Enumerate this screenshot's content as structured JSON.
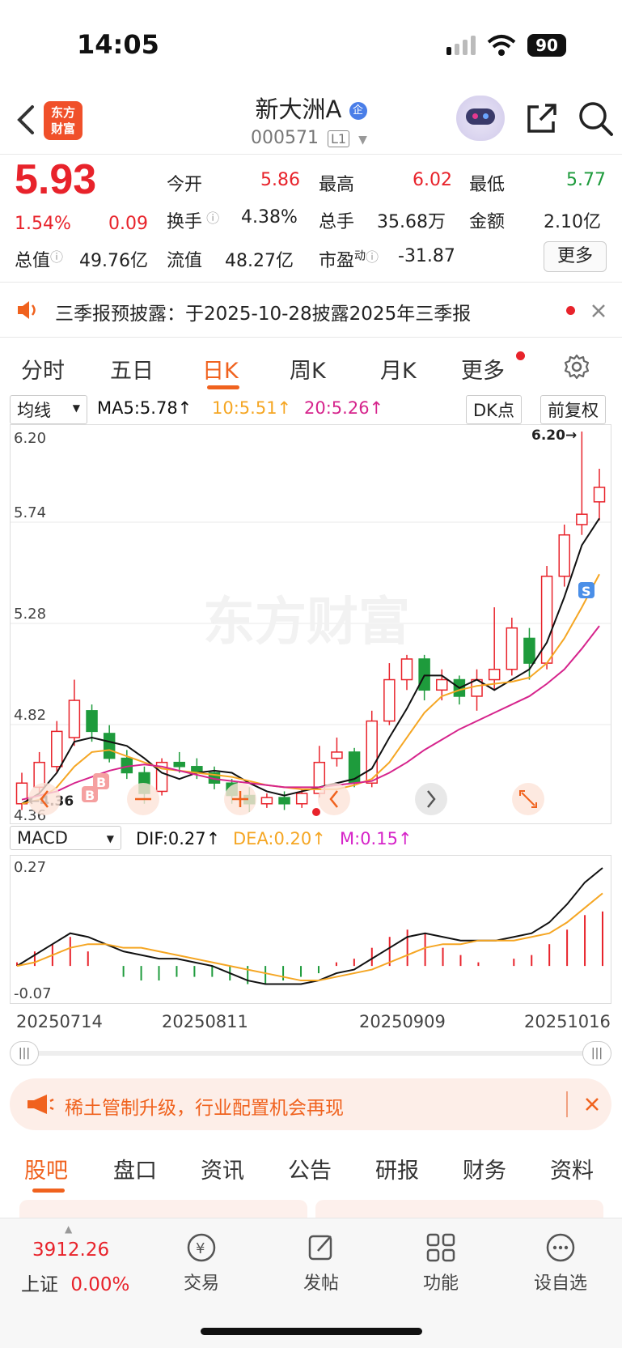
{
  "status": {
    "time": "14:05",
    "battery": "90"
  },
  "header": {
    "logo_text": "东方财富",
    "title": "新大洲A",
    "code": "000571",
    "level_badge": "L1"
  },
  "quote": {
    "price": "5.93",
    "change_pct": "1.54%",
    "change": "0.09",
    "open_label": "今开",
    "open_value": "5.86",
    "high_label": "最高",
    "high_value": "6.02",
    "low_label": "最低",
    "low_value": "5.77",
    "turnover_label": "换手",
    "turnover_value": "4.38%",
    "volume_label": "总手",
    "volume_value": "35.68万",
    "amount_label": "金额",
    "amount_value": "2.10亿",
    "total_mv_label": "总值",
    "total_mv_value": "49.76亿",
    "float_mv_label": "流值",
    "float_mv_value": "48.27亿",
    "pe_label": "市盈",
    "pe_superscript": "动",
    "pe_value": "-31.87",
    "more_button": "更多"
  },
  "notice": {
    "text": "三季报预披露：于2025-10-28披露2025年三季报"
  },
  "period_tabs": {
    "items": [
      "分时",
      "五日",
      "日K",
      "周K",
      "月K",
      "更多"
    ],
    "active": "日K"
  },
  "indicator_bar": {
    "ma_select": "均线",
    "ma5": "MA5:5.78↑",
    "ma10": "10:5.51↑",
    "ma20": "20:5.26↑",
    "dk_button": "DK点",
    "adjust_button": "前复权"
  },
  "colors": {
    "up": "#e8232b",
    "down": "#1e9b3c",
    "ma5": "#111111",
    "ma10": "#f5a623",
    "ma20": "#d6248c",
    "accent": "#f0621e"
  },
  "chart_data": [
    {
      "type": "candlestick",
      "y_ticks": [
        "6.20",
        "5.74",
        "5.28",
        "4.82",
        "4.36"
      ],
      "ylim": [
        4.36,
        6.2
      ],
      "max_label": "6.20→",
      "min_label": "←4.36",
      "watermark": "东方财富",
      "markers": [
        "B",
        "B",
        "S"
      ],
      "series": [
        {
          "name": "MA5",
          "values": [
            4.4,
            4.45,
            4.55,
            4.7,
            4.72,
            4.7,
            4.68,
            4.62,
            4.55,
            4.52,
            4.55,
            4.56,
            4.55,
            4.5,
            4.46,
            4.44,
            4.46,
            4.48,
            4.5,
            4.52,
            4.57,
            4.72,
            4.86,
            5.02,
            5.02,
            4.96,
            5.0,
            4.95,
            5.0,
            5.05,
            5.18,
            5.4,
            5.65,
            5.78
          ]
        },
        {
          "name": "10",
          "values": [
            4.4,
            4.42,
            4.48,
            4.58,
            4.65,
            4.66,
            4.63,
            4.6,
            4.57,
            4.56,
            4.55,
            4.54,
            4.53,
            4.51,
            4.49,
            4.48,
            4.47,
            4.47,
            4.47,
            4.49,
            4.52,
            4.6,
            4.72,
            4.84,
            4.92,
            4.95,
            4.97,
            4.98,
            4.99,
            5.01,
            5.08,
            5.2,
            5.35,
            5.51
          ]
        },
        {
          "name": "20",
          "values": [
            4.42,
            4.44,
            4.46,
            4.5,
            4.53,
            4.56,
            4.58,
            4.59,
            4.58,
            4.56,
            4.54,
            4.52,
            4.51,
            4.5,
            4.49,
            4.48,
            4.48,
            4.48,
            4.49,
            4.5,
            4.51,
            4.55,
            4.6,
            4.66,
            4.71,
            4.76,
            4.8,
            4.84,
            4.88,
            4.92,
            4.98,
            5.05,
            5.15,
            5.26
          ]
        }
      ],
      "candles": [
        [
          4.4,
          4.5,
          4.55,
          4.37
        ],
        [
          4.48,
          4.6,
          4.65,
          4.45
        ],
        [
          4.58,
          4.75,
          4.8,
          4.55
        ],
        [
          4.72,
          4.9,
          5.0,
          4.68
        ],
        [
          4.85,
          4.75,
          4.88,
          4.7
        ],
        [
          4.74,
          4.62,
          4.78,
          4.6
        ],
        [
          4.62,
          4.55,
          4.66,
          4.52
        ],
        [
          4.55,
          4.45,
          4.58,
          4.4
        ],
        [
          4.46,
          4.6,
          4.62,
          4.44
        ],
        [
          4.6,
          4.58,
          4.65,
          4.55
        ],
        [
          4.58,
          4.55,
          4.62,
          4.52
        ],
        [
          4.55,
          4.5,
          4.58,
          4.47
        ],
        [
          4.5,
          4.44,
          4.52,
          4.4
        ],
        [
          4.44,
          4.4,
          4.48,
          4.36
        ],
        [
          4.4,
          4.43,
          4.45,
          4.38
        ],
        [
          4.43,
          4.4,
          4.46,
          4.37
        ],
        [
          4.4,
          4.45,
          4.47,
          4.38
        ],
        [
          4.45,
          4.6,
          4.68,
          4.43
        ],
        [
          4.62,
          4.65,
          4.72,
          4.58
        ],
        [
          4.65,
          4.5,
          4.67,
          4.48
        ],
        [
          4.5,
          4.8,
          4.85,
          4.48
        ],
        [
          4.8,
          5.0,
          5.08,
          4.78
        ],
        [
          5.0,
          5.1,
          5.12,
          4.95
        ],
        [
          5.1,
          4.95,
          5.12,
          4.9
        ],
        [
          4.95,
          5.0,
          5.05,
          4.9
        ],
        [
          5.0,
          4.92,
          5.02,
          4.88
        ],
        [
          4.92,
          5.0,
          5.05,
          4.85
        ],
        [
          5.0,
          5.05,
          5.35,
          4.95
        ],
        [
          5.05,
          5.25,
          5.3,
          5.02
        ],
        [
          5.2,
          5.08,
          5.25,
          5.0
        ],
        [
          5.08,
          5.5,
          5.55,
          5.05
        ],
        [
          5.5,
          5.7,
          5.75,
          5.45
        ],
        [
          5.75,
          5.8,
          6.2,
          5.7
        ],
        [
          5.86,
          5.93,
          6.02,
          5.77
        ]
      ]
    },
    {
      "type": "macd",
      "y_ticks": [
        "0.27",
        "-0.07"
      ],
      "series": [
        {
          "name": "DIF",
          "label": "DIF:0.27↑"
        },
        {
          "name": "DEA",
          "label": "DEA:0.20↑"
        },
        {
          "name": "M",
          "label": "M:0.15↑"
        }
      ],
      "dif": [
        0.0,
        0.03,
        0.06,
        0.09,
        0.08,
        0.06,
        0.04,
        0.03,
        0.02,
        0.02,
        0.01,
        0.0,
        -0.02,
        -0.04,
        -0.05,
        -0.05,
        -0.05,
        -0.04,
        -0.02,
        -0.01,
        0.02,
        0.05,
        0.08,
        0.09,
        0.08,
        0.07,
        0.07,
        0.07,
        0.08,
        0.09,
        0.12,
        0.17,
        0.23,
        0.27
      ],
      "dea": [
        0.0,
        0.01,
        0.03,
        0.05,
        0.06,
        0.06,
        0.05,
        0.05,
        0.04,
        0.03,
        0.02,
        0.01,
        0.0,
        -0.01,
        -0.02,
        -0.03,
        -0.04,
        -0.04,
        -0.03,
        -0.02,
        -0.01,
        0.01,
        0.03,
        0.05,
        0.06,
        0.06,
        0.07,
        0.07,
        0.07,
        0.08,
        0.09,
        0.12,
        0.16,
        0.2
      ],
      "macd": [
        0.01,
        0.04,
        0.06,
        0.08,
        0.04,
        0.0,
        -0.03,
        -0.04,
        -0.04,
        -0.03,
        -0.03,
        -0.03,
        -0.04,
        -0.05,
        -0.05,
        -0.04,
        -0.03,
        -0.02,
        0.01,
        0.02,
        0.05,
        0.08,
        0.1,
        0.09,
        0.05,
        0.03,
        0.01,
        0.0,
        0.02,
        0.03,
        0.06,
        0.1,
        0.14,
        0.15
      ]
    }
  ],
  "dates": [
    "20250714",
    "20250811",
    "20250909",
    "20251016"
  ],
  "macd_select": "MACD",
  "banner": {
    "text": "稀土管制升级，行业配置机会再现"
  },
  "bottom_tabs": {
    "items": [
      "股吧",
      "盘口",
      "资讯",
      "公告",
      "研报",
      "财务",
      "资料"
    ],
    "active": "股吧"
  },
  "bottom_bar": {
    "index_value": "3912.26",
    "index_name": "上证",
    "index_change": "0.00%",
    "trade": "交易",
    "post": "发帖",
    "function": "功能",
    "watchlist": "设自选"
  }
}
